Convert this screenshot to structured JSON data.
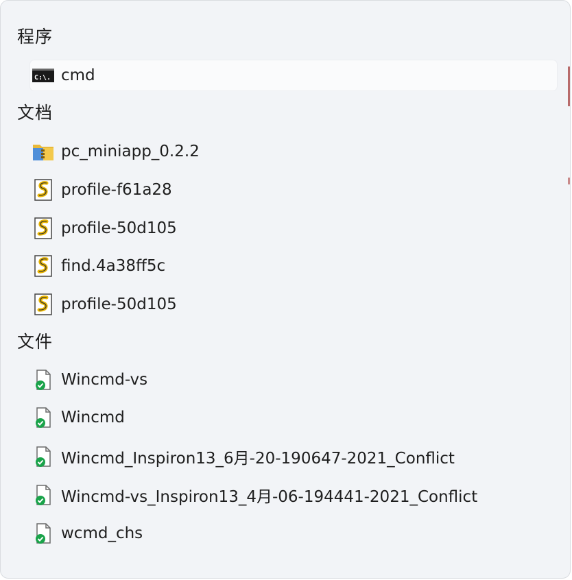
{
  "sections": [
    {
      "header": "程序",
      "items": [
        {
          "label": "cmd",
          "icon": "command-prompt-icon"
        }
      ]
    },
    {
      "header": "文档",
      "items": [
        {
          "label": "pc_miniapp_0.2.2",
          "icon": "zip-folder-icon"
        },
        {
          "label": "profile-f61a28",
          "icon": "script-file-icon"
        },
        {
          "label": "profile-50d105",
          "icon": "script-file-icon"
        },
        {
          "label": "find.4a38ff5c",
          "icon": "script-file-icon"
        },
        {
          "label": "profile-50d105",
          "icon": "script-file-icon"
        }
      ]
    },
    {
      "header": "文件",
      "items": [
        {
          "label": "Wincmd-vs",
          "icon": "synced-file-icon"
        },
        {
          "label": "Wincmd",
          "icon": "synced-file-icon"
        },
        {
          "label": "Wincmd_Inspiron13_6月-20-190647-2021_Conflict",
          "icon": "synced-file-icon"
        },
        {
          "label": "Wincmd-vs_Inspiron13_4月-06-194441-2021_Conflict",
          "icon": "synced-file-icon"
        },
        {
          "label": "wcmd_chs",
          "icon": "synced-file-icon"
        }
      ]
    }
  ],
  "colors": {
    "panel_background": "#f2f4f7",
    "selected_background": "#fafbfc",
    "sync_check": "#1aa34a",
    "script_icon": "#e8b400"
  }
}
